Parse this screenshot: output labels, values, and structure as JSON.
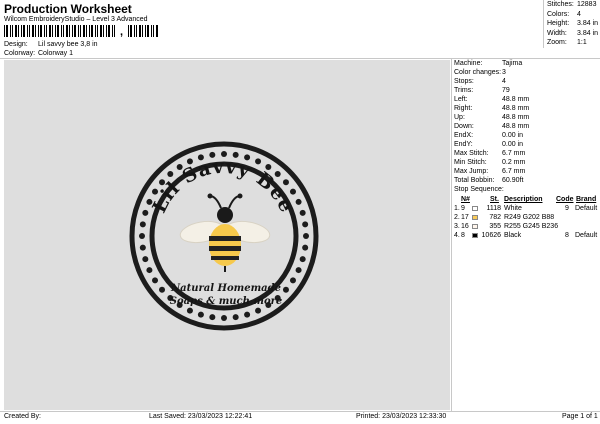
{
  "header": {
    "title": "Production Worksheet",
    "subtitle": "Wilcom EmbroideryStudio – Level 3 Advanced",
    "barcode_sep": ","
  },
  "meta": {
    "design_label": "Design:",
    "design_value": "Lil savvy bee 3,8 in",
    "colorway_label": "Colorway:",
    "colorway_value": "Colorway 1"
  },
  "stats": [
    {
      "k": "Stitches:",
      "v": "12883"
    },
    {
      "k": "Colors:",
      "v": "4"
    },
    {
      "k": "Height:",
      "v": "3.84 in"
    },
    {
      "k": "Width:",
      "v": "3.84 in"
    },
    {
      "k": "Zoom:",
      "v": "1:1"
    }
  ],
  "design": {
    "arc_text": "Lil Savvy Bee",
    "line1": "Natural Homemade",
    "line2": "Soaps & much more"
  },
  "machine_info": [
    {
      "k": "Machine:",
      "v": "Tajima"
    },
    {
      "k": "Color changes:",
      "v": "3"
    },
    {
      "k": "Stops:",
      "v": "4"
    },
    {
      "k": "Trims:",
      "v": "79"
    },
    {
      "k": "Left:",
      "v": "48.8 mm"
    },
    {
      "k": "Right:",
      "v": "48.8 mm"
    },
    {
      "k": "Up:",
      "v": "48.8 mm"
    },
    {
      "k": "Down:",
      "v": "48.8 mm"
    },
    {
      "k": "EndX:",
      "v": "0.00 in"
    },
    {
      "k": "EndY:",
      "v": "0.00 in"
    },
    {
      "k": "Max Stitch:",
      "v": "6.7 mm"
    },
    {
      "k": "Min Stitch:",
      "v": "0.2 mm"
    },
    {
      "k": "Max Jump:",
      "v": "6.7 mm"
    },
    {
      "k": "Total Bobbin:",
      "v": "60.90ft"
    }
  ],
  "stop_sequence": {
    "label": "Stop Sequence:",
    "headers": {
      "n": "N#",
      "st": "St.",
      "desc": "Description",
      "code": "Code",
      "brand": "Brand"
    },
    "rows": [
      {
        "idx": "1.",
        "n": "9",
        "color": "#ffffff",
        "st": "1118",
        "desc": "White",
        "code": "9",
        "brand": "Default"
      },
      {
        "idx": "2.",
        "n": "17",
        "color": "#f9ca58",
        "st": "782",
        "desc": "R249 G202 B88",
        "code": "",
        "brand": ""
      },
      {
        "idx": "3.",
        "n": "16",
        "color": "#fff5ec",
        "st": "355",
        "desc": "R255 G245 B236",
        "code": "",
        "brand": ""
      },
      {
        "idx": "4.",
        "n": "8",
        "color": "#000000",
        "st": "10626",
        "desc": "Black",
        "code": "8",
        "brand": "Default"
      }
    ]
  },
  "footer": {
    "created": "Created By:",
    "saved": "Last Saved: 23/03/2023 12:22:41",
    "printed": "Printed: 23/03/2023 12:33:30",
    "page": "Page 1 of 1"
  }
}
